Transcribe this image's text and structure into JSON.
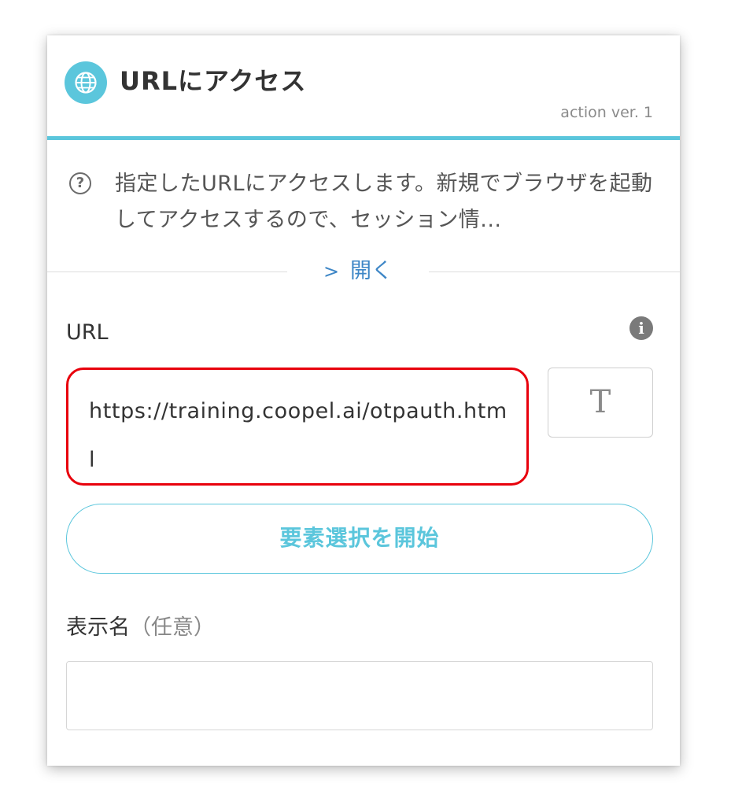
{
  "header": {
    "icon": "globe-icon",
    "title": "URLにアクセス",
    "version": "action ver. 1",
    "accent_color": "#5bc6dc"
  },
  "description": {
    "icon": "help-circle-icon",
    "text": "指定したURLにアクセスします。新規でブラウザを起動してアクセスするので、セッション情...",
    "expand_label": "開く",
    "expand_icon": "chevron-right-icon"
  },
  "url_field": {
    "label": "URL",
    "info_icon": "info-icon",
    "value": "https://training.coopel.ai/otpauth.html",
    "highlight_color": "#e8000c"
  },
  "text_mode_button": {
    "label": "T",
    "icon": "text-mode-icon"
  },
  "element_select_button": {
    "label": "要素選択を開始"
  },
  "display_name": {
    "label": "表示名",
    "optional_label": "（任意）",
    "value": ""
  }
}
